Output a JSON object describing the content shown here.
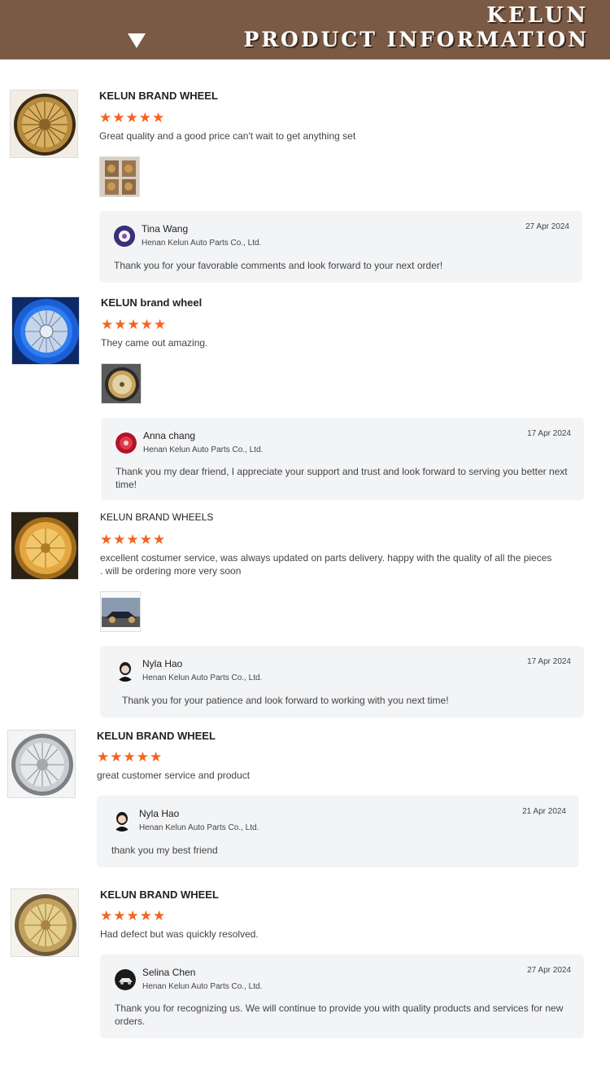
{
  "banner": {
    "brand": "KELUN",
    "subtitle": "PRODUCT INFORMATION"
  },
  "reviews": [
    {
      "title": "KELUN BRAND WHEEL",
      "stars": "★★★★★",
      "rating": 5,
      "text": "Great quality and a good price can't wait to get anything set",
      "reply": {
        "name": "Tina Wang",
        "company": "Henan Kelun Auto Parts Co., Ltd.",
        "date": "27 Apr 2024",
        "message": "Thank you for your favorable comments and look forward to your next order!"
      }
    },
    {
      "title": "KELUN brand wheel",
      "stars": "★★★★★",
      "rating": 5,
      "text": "They came out amazing.",
      "reply": {
        "name": "Anna chang",
        "company": "Henan Kelun Auto Parts Co., Ltd.",
        "date": "17 Apr 2024",
        "message": "Thank you my dear friend, I appreciate your support and trust and look forward to serving you better next time!"
      }
    },
    {
      "title": "KELUN BRAND WHEELS",
      "stars": "★★★★★",
      "rating": 5,
      "text": "excellent costumer service, was always updated on parts delivery. happy with the quality of all the pieces . will be ordering more very soon",
      "reply": {
        "name": "Nyla Hao",
        "company": "Henan Kelun Auto Parts Co., Ltd.",
        "date": "17 Apr 2024",
        "message": "Thank you for your patience and look forward to working with you next time!"
      }
    },
    {
      "title": "KELUN BRAND WHEEL",
      "stars": "★★★★★",
      "rating": 5,
      "text": "great customer service and product",
      "reply": {
        "name": "Nyla Hao",
        "company": "Henan Kelun Auto Parts Co., Ltd.",
        "date": "21 Apr 2024",
        "message": "thank you my best  friend"
      }
    },
    {
      "title": "KELUN BRAND WHEEL",
      "stars": "★★★★★",
      "rating": 5,
      "text": "Had defect but was quickly resolved.",
      "reply": {
        "name": "Selina Chen",
        "company": "Henan Kelun Auto Parts Co., Ltd.",
        "date": "27 Apr 2024",
        "message": "Thank you for recognizing us. We will continue to provide you with quality products and services for new orders."
      }
    }
  ],
  "colors": {
    "banner": "#7a5a45",
    "star": "#f5631f",
    "reply_bg": "#f3f4f6"
  },
  "icons": [
    "down-triangle-icon",
    "star-icon"
  ]
}
